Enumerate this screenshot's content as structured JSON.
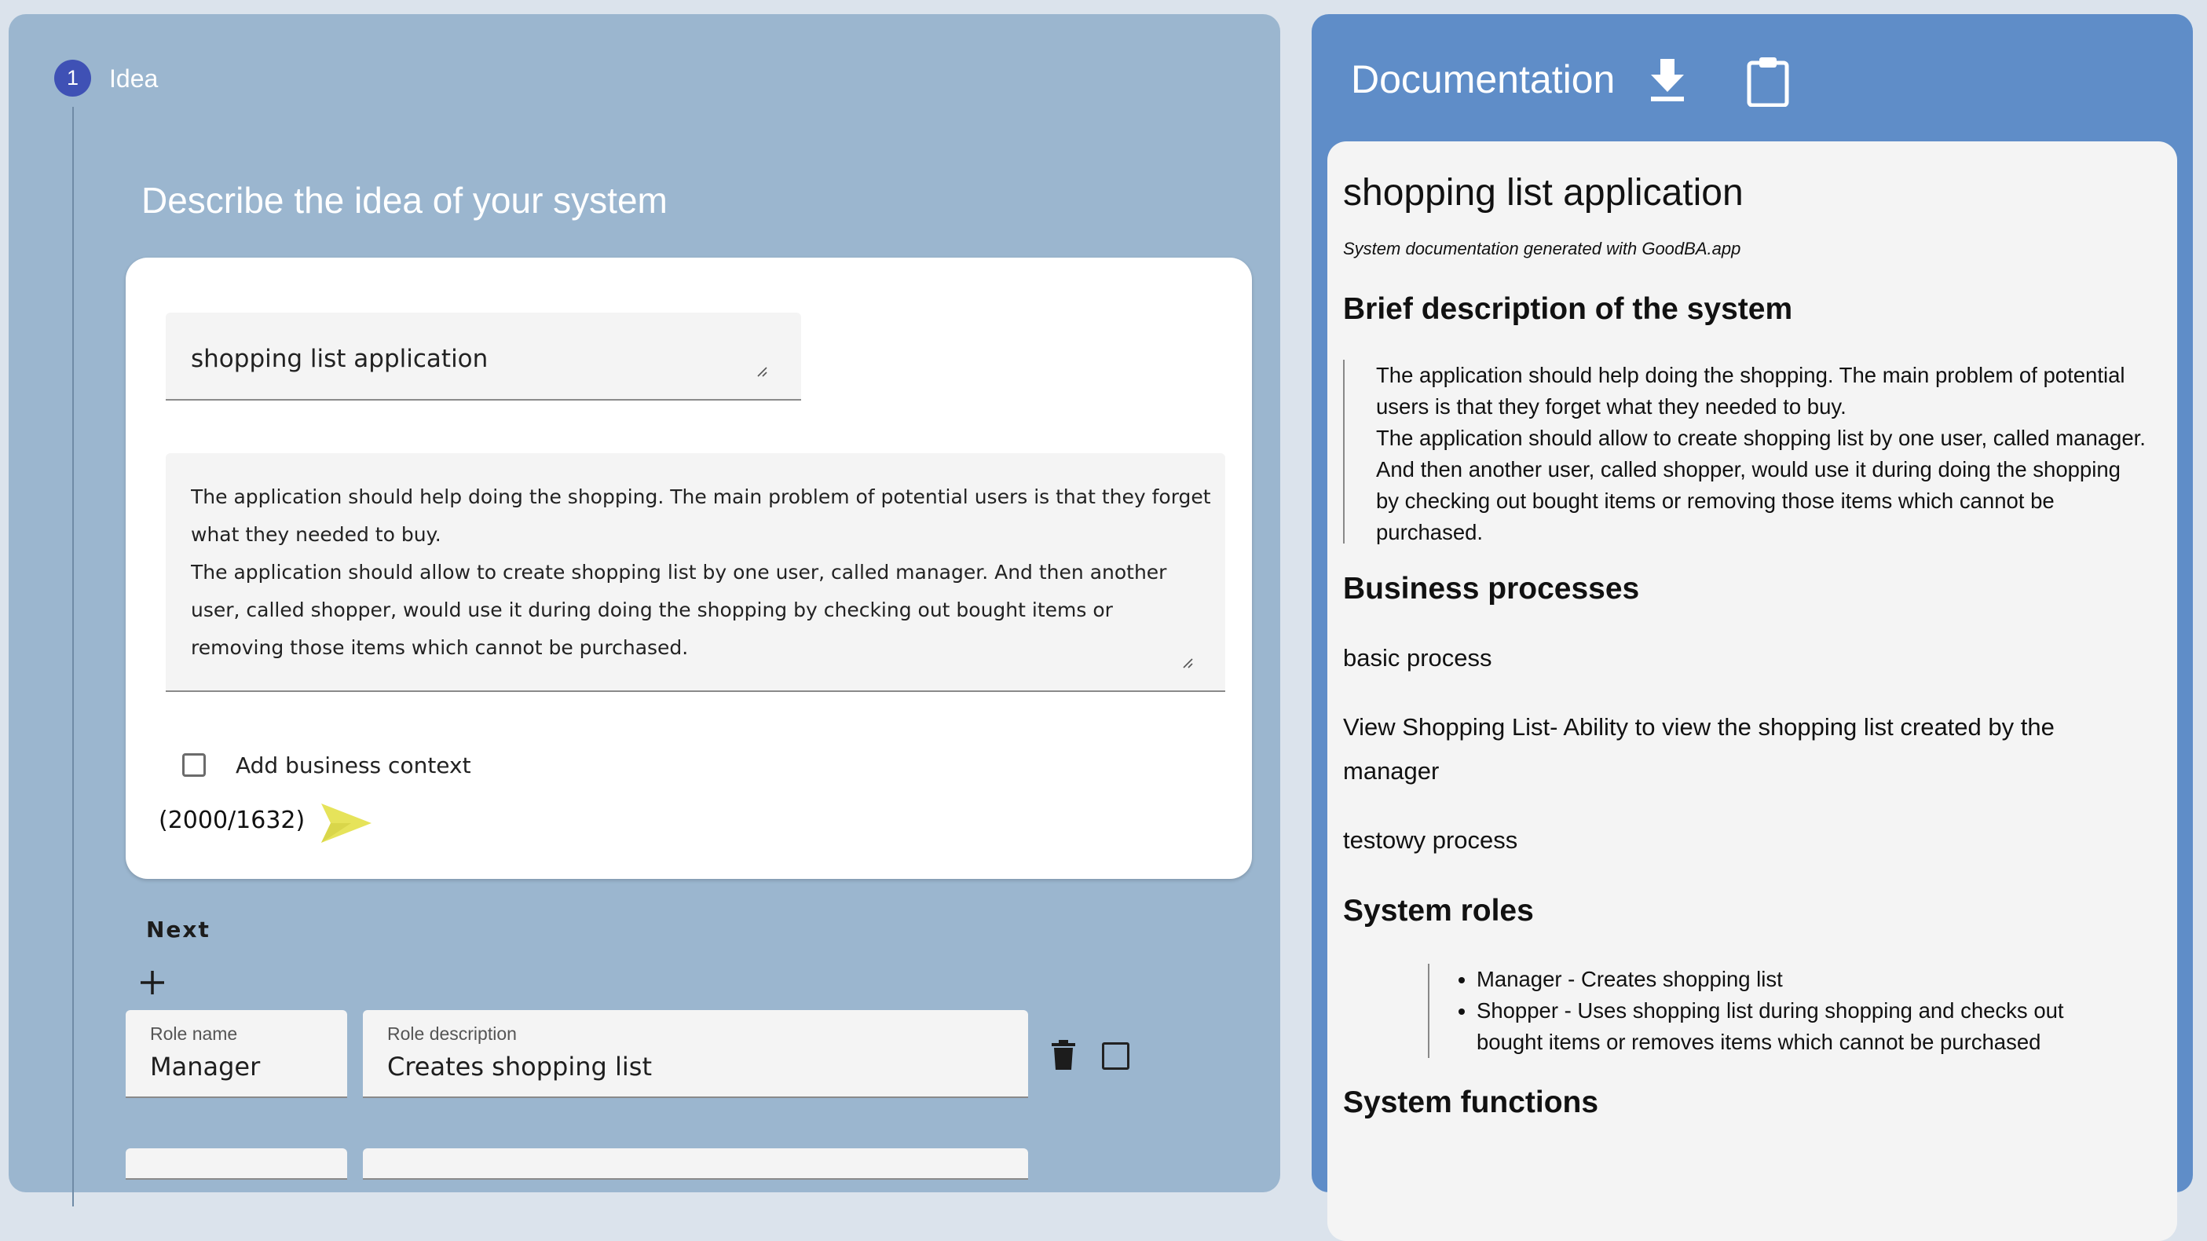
{
  "stepper": {
    "step_number": "1",
    "step_label": "Idea"
  },
  "idea": {
    "section_title": "Describe the idea of your system",
    "system_name": "shopping list application",
    "description": "The application should help doing the shopping. The main problem of potential users is that they forget what they needed to buy.\nThe application should allow to create shopping list by one user, called manager. And then another user, called shopper, would use it during doing the shopping by checking out bought items or removing those items which cannot be purchased.",
    "business_context_label": "Add business context",
    "business_context_checked": false,
    "char_counter": "(2000/1632)",
    "send_icon": "send-icon",
    "send_color": "#e6e35a",
    "next_label": "Next",
    "add_icon": "plus-icon"
  },
  "roles": {
    "name_label": "Role name",
    "description_label": "Role description",
    "items": [
      {
        "name": "Manager",
        "description": "Creates shopping list"
      }
    ],
    "delete_icon": "trash-icon"
  },
  "documentation": {
    "panel_title": "Documentation",
    "download_icon": "download-icon",
    "copy_icon": "clipboard-icon",
    "title": "shopping list application",
    "generated_note": "System documentation generated with GoodBA.app",
    "brief_heading": "Brief description of the system",
    "brief_text": "The application should help doing the shopping. The main problem of potential users is that they forget what they needed to buy.\nThe application should allow to create shopping list by one user, called manager. And then another user, called shopper, would use it during doing the shopping by checking out bought items or removing those items which cannot be purchased.",
    "processes_heading": "Business processes",
    "processes": [
      "basic process",
      "View Shopping List- Ability to view the shopping list created by the manager",
      "testowy process"
    ],
    "roles_heading": "System roles",
    "roles": [
      "Manager - Creates shopping list",
      "Shopper - Uses shopping list during shopping and checks out bought items or removes items which cannot be purchased"
    ],
    "functions_heading": "System functions"
  },
  "colors": {
    "left_panel": "#9bb6cf",
    "right_panel": "#5f8dc8",
    "step_circle": "#3f51b5"
  }
}
